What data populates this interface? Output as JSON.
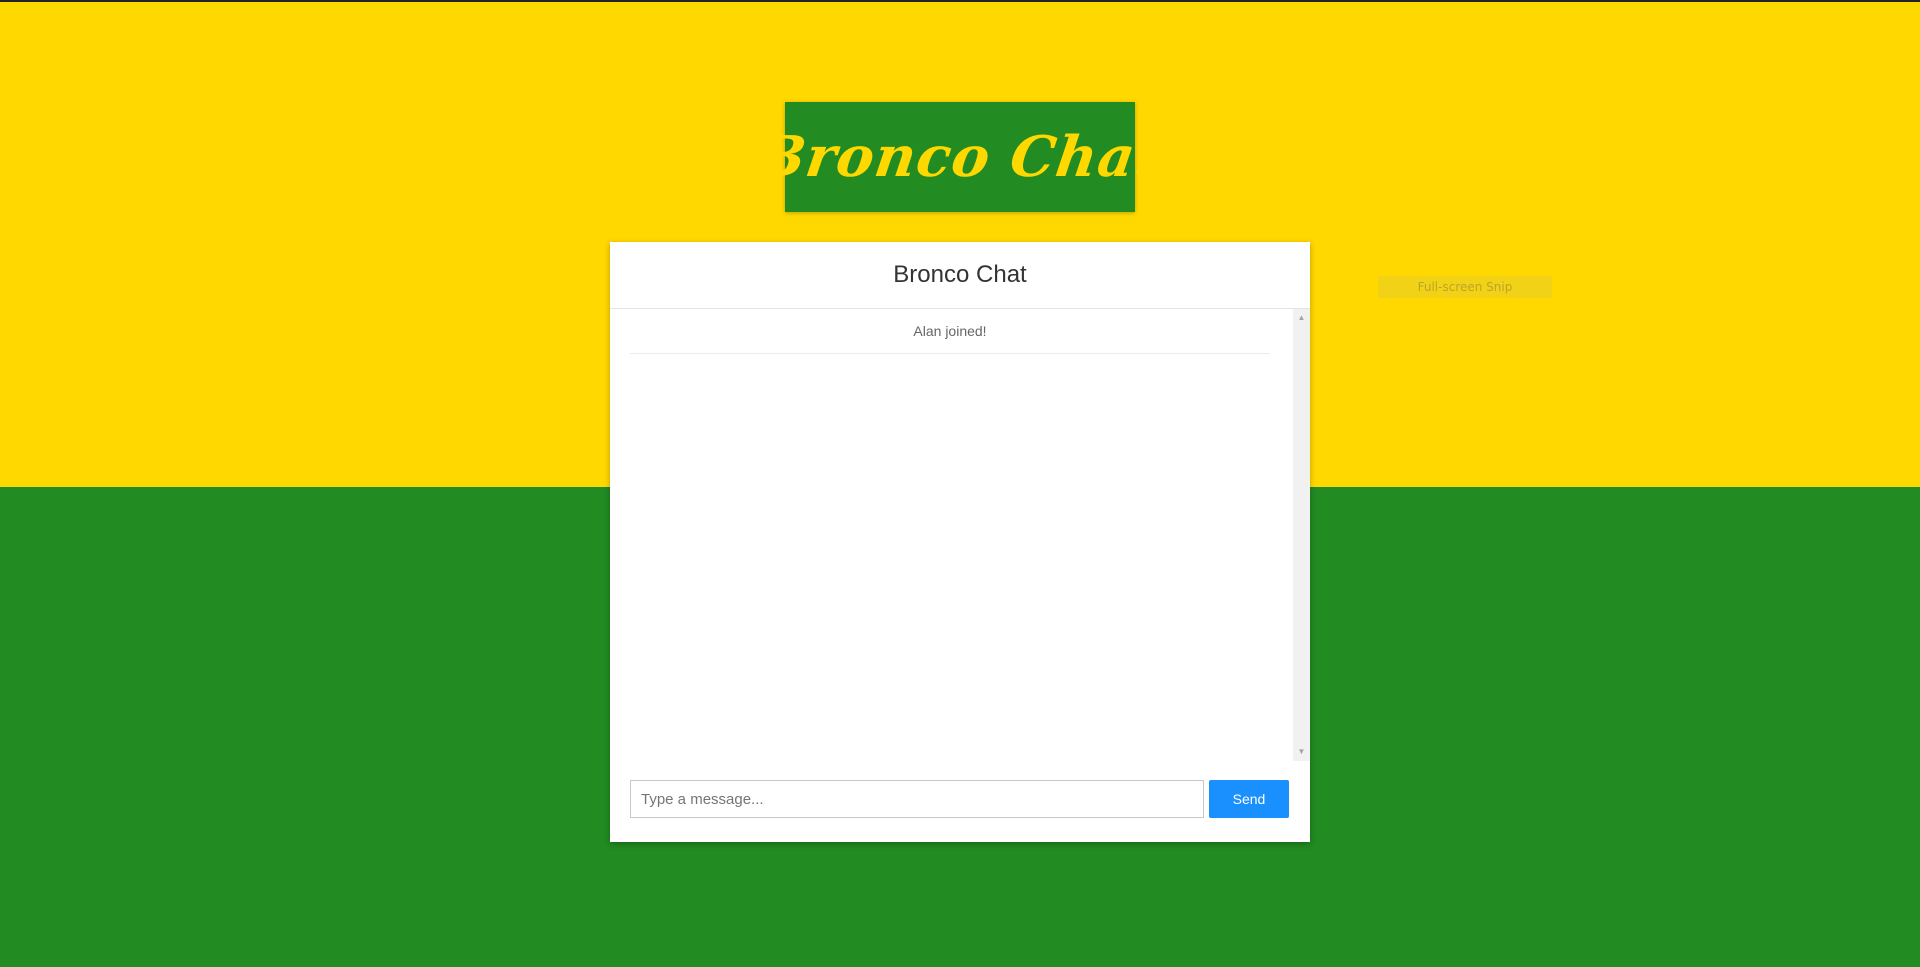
{
  "colors": {
    "yellow": "#ffd800",
    "green": "#228b22",
    "send_button": "#1a90ff"
  },
  "logo": {
    "text": "Bronco Chat"
  },
  "overlay": {
    "text": "Full-screen Snip"
  },
  "chat": {
    "title": "Bronco Chat",
    "messages": [
      {
        "text": "Alan joined!"
      }
    ],
    "input_placeholder": "Type a message...",
    "input_value": "",
    "send_label": "Send"
  }
}
